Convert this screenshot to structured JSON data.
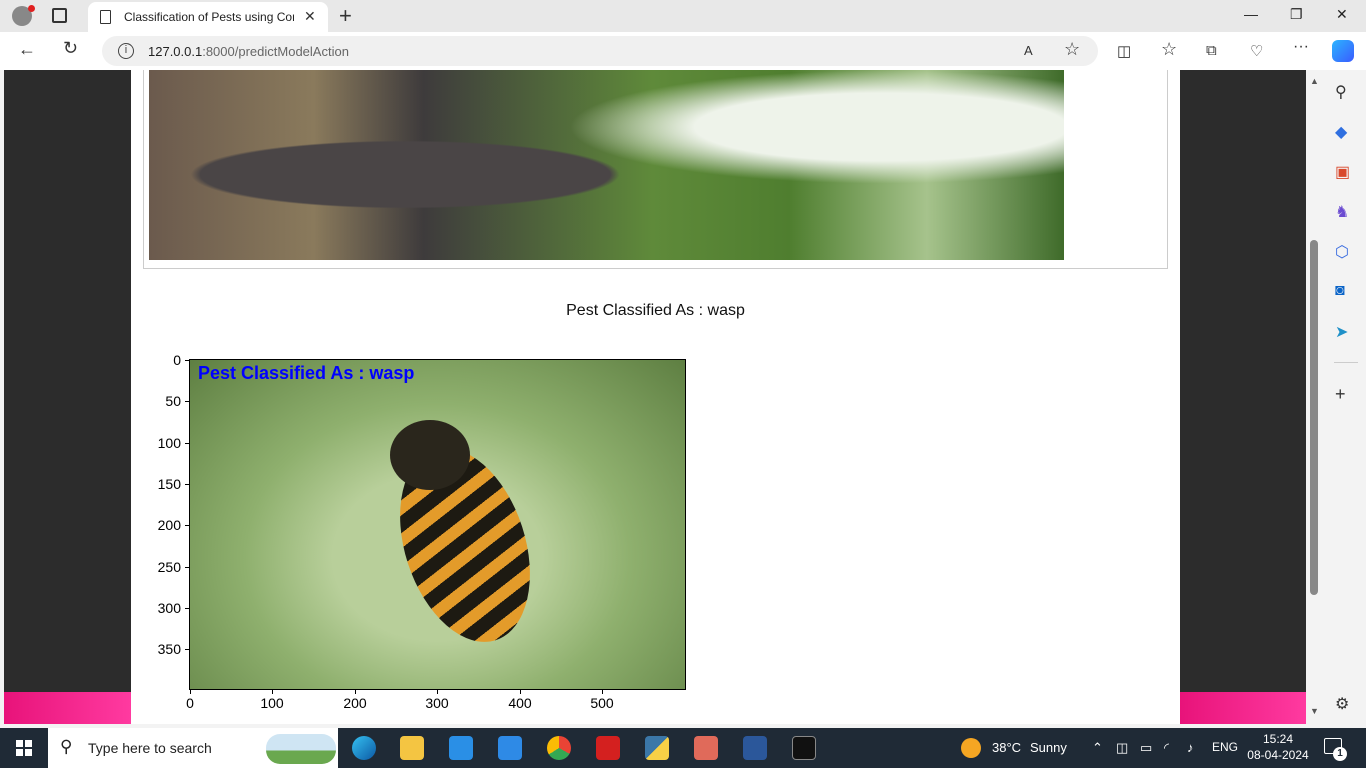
{
  "browser": {
    "tab_title": "Classification of Pests using Com",
    "url_host": "127.0.0.1",
    "url_rest": ":8000/predictModelAction"
  },
  "page": {
    "result_text": "Pest Classified As : wasp",
    "overlay_label": "Pest Classified As : wasp",
    "y_ticks": [
      "0",
      "50",
      "100",
      "150",
      "200",
      "250",
      "300",
      "350"
    ],
    "x_ticks": [
      "0",
      "100",
      "200",
      "300",
      "400",
      "500"
    ]
  },
  "taskbar": {
    "search_placeholder": "Type here to search",
    "weather_temp": "38°C",
    "weather_desc": "Sunny",
    "lang": "ENG",
    "time": "15:24",
    "date": "08-04-2024",
    "notifications": "1"
  },
  "colors": {
    "pink_band": "#e8137a",
    "overlay_text": "#0000ff"
  }
}
